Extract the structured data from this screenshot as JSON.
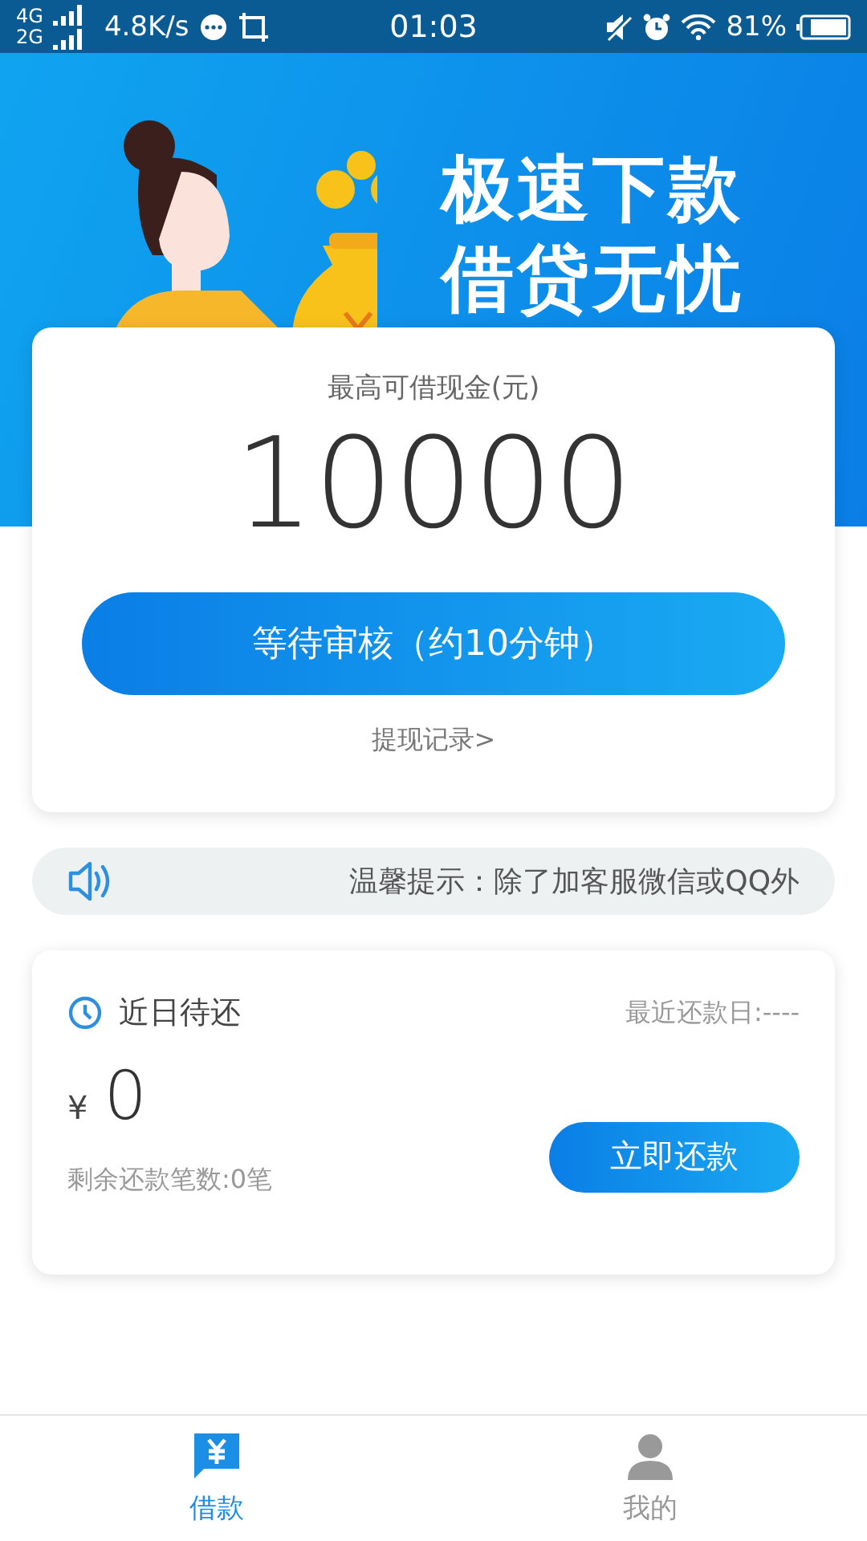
{
  "status_bar": {
    "network_top": "4G",
    "network_bottom": "2G",
    "speed": "4.8K/s",
    "time": "01:03",
    "battery": "81%"
  },
  "banner": {
    "slogan_lines": [
      "极速下款",
      "借贷无忧"
    ]
  },
  "loan_card": {
    "label": "最高可借现金(元)",
    "amount": "10000",
    "button": "等待审核（约10分钟）",
    "link": "提现记录>"
  },
  "notice": {
    "text": "温馨提示：除了加客服微信或QQ外"
  },
  "repay_card": {
    "title": "近日待还",
    "date_label": "最近还款日:----",
    "currency": "¥",
    "amount": "0",
    "count_text": "剩余还款笔数:0笔",
    "button": "立即还款"
  },
  "tabs": [
    {
      "label": "借款",
      "kind": "loan",
      "selected": true
    },
    {
      "label": "我的",
      "kind": "profile",
      "selected": false
    }
  ]
}
